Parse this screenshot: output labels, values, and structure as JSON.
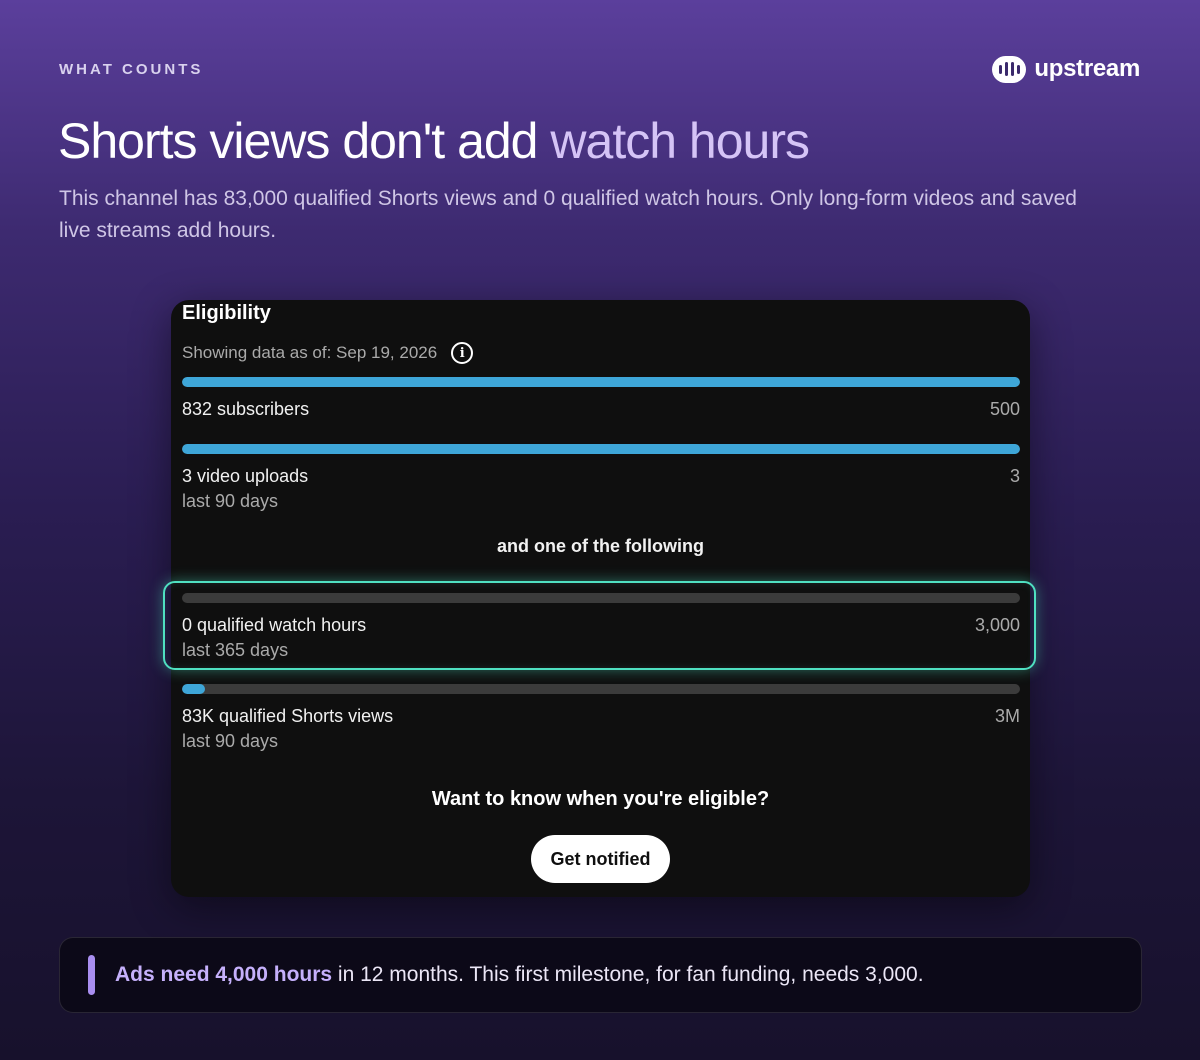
{
  "header": {
    "eyebrow": "WHAT COUNTS",
    "brand_name": "upstream",
    "headline_plain": "Shorts views don't add",
    "headline_accent": "watch hours",
    "subtext": "This channel has 83,000 qualified Shorts views and 0 qualified watch hours. Only long-form videos and saved live streams add hours."
  },
  "card": {
    "title": "Eligibility",
    "as_of": "Showing data as of: Sep 19, 2026",
    "metrics": [
      {
        "label": "832 subscribers",
        "target": "500",
        "sublabel": "",
        "progress": 1.0
      },
      {
        "label": "3 video uploads",
        "target": "3",
        "sublabel": "last 90 days",
        "progress": 1.0
      },
      {
        "label": "0 qualified watch hours",
        "target": "3,000",
        "sublabel": "last 365 days",
        "progress": 0.0
      },
      {
        "label": "83K qualified Shorts views",
        "target": "3M",
        "sublabel": "last 90 days",
        "progress": 0.028
      }
    ],
    "one_of_label": "and one of the following",
    "cta_question": "Want to know when you're eligible?",
    "cta_button": "Get notified"
  },
  "footnote": {
    "emphasis": "Ads need 4,000 hours",
    "rest": " in 12 months. This first milestone, for fan funding, needs 3,000."
  },
  "colors": {
    "progress_fill": "#3ea6d8",
    "highlight_border": "#4fe0c1",
    "accent_text": "#d5c4f6"
  }
}
